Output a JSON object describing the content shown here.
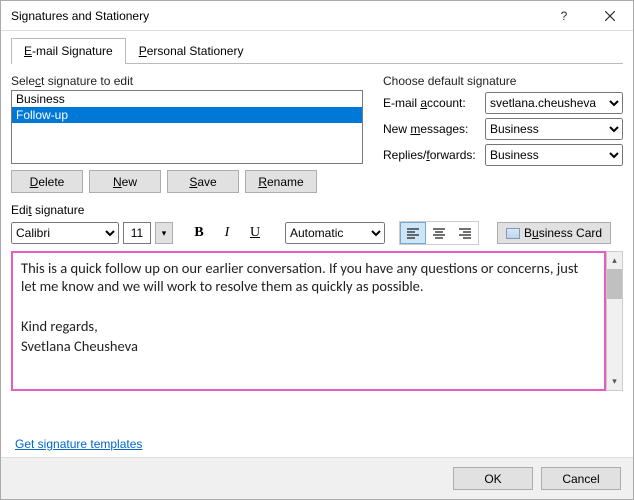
{
  "window": {
    "title": "Signatures and Stationery"
  },
  "tabs": {
    "email": "E-mail Signature",
    "stationery": "Personal Stationery"
  },
  "select_section": {
    "label": "Select signature to edit",
    "items": [
      "Business",
      "Follow-up"
    ],
    "selected_index": 1,
    "buttons": {
      "delete": "Delete",
      "new": "New",
      "save": "Save",
      "rename": "Rename"
    }
  },
  "default_section": {
    "label": "Choose default signature",
    "email_account_label": "E-mail account:",
    "email_account_value": "svetlana.cheusheva",
    "new_messages_label": "New messages:",
    "new_messages_value": "Business",
    "replies_label": "Replies/forwards:",
    "replies_value": "Business"
  },
  "edit_section": {
    "label": "Edit signature",
    "font": "Calibri",
    "size": "11",
    "color": "Automatic",
    "business_card": "Business Card",
    "body_line1": "This is a quick follow up on our earlier conversation. If you have any questions or concerns, just let me know and we will work to resolve them as quickly as possible.",
    "body_line2": "Kind regards,",
    "body_line3": "Svetlana Cheusheva"
  },
  "link_text": "Get signature templates",
  "footer": {
    "ok": "OK",
    "cancel": "Cancel"
  }
}
